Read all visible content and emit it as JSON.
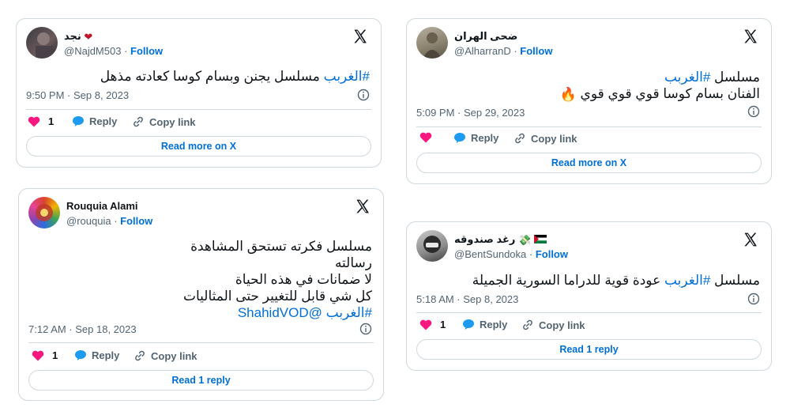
{
  "follow_label": "Follow",
  "actions": {
    "reply": "Reply",
    "copy": "Copy link"
  },
  "tweets": [
    {
      "name": "نجد",
      "handle": "@NajdM503",
      "hashtag": "#الغربب",
      "text": " مسلسل يجنن وبسام كوسا كعادته مذهل",
      "time": "9:50 PM · Sep 8, 2023",
      "likes": "1",
      "button": "Read more on X"
    },
    {
      "name": "ضحى الهران",
      "handle": "@AlharranD",
      "line1_pre": "مسلسل ",
      "hashtag": "#الغربب",
      "line2": "الفنان بسام كوسا قوي قوي قوي",
      "time": "5:09 PM · Sep 29, 2023",
      "likes": "",
      "button": "Read more on X"
    },
    {
      "name": "Rouquia Alami",
      "handle": "@rouquia",
      "lines": [
        "مسلسل فكرته تستحق المشاهدة",
        "رسالته",
        "لا ضمانات في هذه الحياة",
        "كل شي قابل للتغيير حتى المثاليات"
      ],
      "hashtag": "#الغربب",
      "mention": "@ShahidVOD",
      "time": "7:12 AM · Sep 18, 2023",
      "likes": "1",
      "button": "Read 1 reply"
    },
    {
      "name": "رغد صندوقه",
      "handle": "@BentSundoka",
      "line_pre": "مسلسل ",
      "hashtag": "#الغربب",
      "line_post": " عودة قوية للدراما السورية الجميلة",
      "time": "5:18 AM · Sep 8, 2023",
      "likes": "1",
      "button": "Read 1 reply"
    }
  ],
  "colors": {
    "link": "#006fd6",
    "like": "#f91880",
    "reply": "#1d9bf0",
    "border": "#cfd9de",
    "muted": "#536471"
  }
}
